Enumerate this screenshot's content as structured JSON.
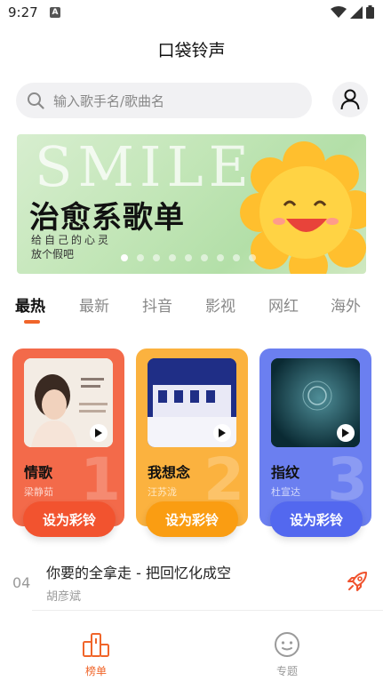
{
  "status": {
    "time": "9:27",
    "notif_icon": "A"
  },
  "header": {
    "title": "口袋铃声"
  },
  "search": {
    "placeholder": "输入歌手名/歌曲名"
  },
  "banner": {
    "bg_text": "SMILE",
    "title": "治愈系歌单",
    "subtitle": "给自己的心灵",
    "subtitle2": "放个假吧",
    "slide_count": 9,
    "active_slide": 1
  },
  "tabs": [
    {
      "label": "最热",
      "active": true
    },
    {
      "label": "最新",
      "active": false
    },
    {
      "label": "抖音",
      "active": false
    },
    {
      "label": "影视",
      "active": false
    },
    {
      "label": "网红",
      "active": false
    },
    {
      "label": "海外",
      "active": false
    }
  ],
  "cards": [
    {
      "rank": "1",
      "song": "情歌",
      "artist": "梁静茹",
      "button": "设为彩铃",
      "color": "#f36a4a",
      "button_color": "#f2532f"
    },
    {
      "rank": "2",
      "song": "我想念",
      "artist": "汪苏泷",
      "button": "设为彩铃",
      "color": "#fbb23f",
      "button_color": "#fa9d12"
    },
    {
      "rank": "3",
      "song": "指纹",
      "artist": "杜宣达",
      "button": "设为彩铃",
      "color": "#6b7ff0",
      "button_color": "#5368ef"
    }
  ],
  "list": [
    {
      "rank": "04",
      "title": "你要的全拿走 - 把回忆化成空",
      "artist": "胡彦斌"
    }
  ],
  "nav": [
    {
      "label": "榜单",
      "active": true,
      "color": "#f0652a"
    },
    {
      "label": "专题",
      "active": false,
      "color": "#999999"
    }
  ]
}
